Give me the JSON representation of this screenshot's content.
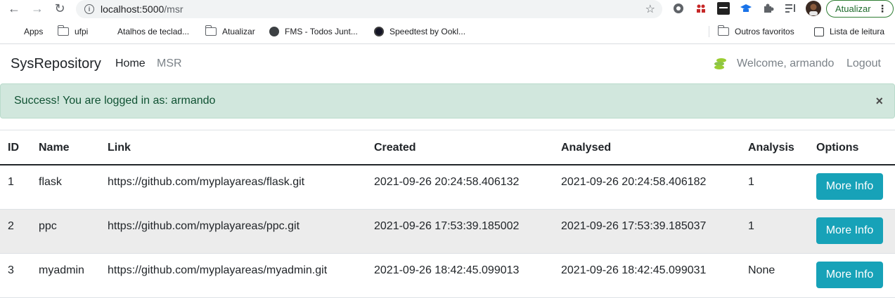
{
  "browser": {
    "url_host": "localhost:5000",
    "url_path": "/msr",
    "update_label": "Atualizar",
    "bookmarks": [
      {
        "label": "Apps",
        "icon": "apps-grid-icon"
      },
      {
        "label": "ufpi",
        "icon": "folder-icon"
      },
      {
        "label": "Atalhos de teclad...",
        "icon": "windows-icon"
      },
      {
        "label": "Atualizar",
        "icon": "folder-icon"
      },
      {
        "label": "FMS - Todos Junt...",
        "icon": "globe-icon"
      },
      {
        "label": "Speedtest by Ookl...",
        "icon": "speedtest-icon"
      }
    ],
    "other_favorites": "Outros favoritos",
    "reading_list": "Lista de leitura"
  },
  "navbar": {
    "brand": "SysRepository",
    "links": [
      "Home",
      "MSR"
    ],
    "welcome": "Welcome, armando",
    "logout": "Logout",
    "accent": "#9acd32"
  },
  "alert": {
    "message": "Success! You are logged in as: armando",
    "close": "×"
  },
  "table": {
    "headers": [
      "ID",
      "Name",
      "Link",
      "Created",
      "Analysed",
      "Analysis",
      "Options"
    ],
    "rows": [
      {
        "id": "1",
        "name": "flask",
        "link": "https://github.com/myplayareas/flask.git",
        "created": "2021-09-26 20:24:58.406132",
        "analysed": "2021-09-26 20:24:58.406182",
        "analysis": "1",
        "option": "More Info"
      },
      {
        "id": "2",
        "name": "ppc",
        "link": "https://github.com/myplayareas/ppc.git",
        "created": "2021-09-26 17:53:39.185002",
        "analysed": "2021-09-26 17:53:39.185037",
        "analysis": "1",
        "option": "More Info"
      },
      {
        "id": "3",
        "name": "myadmin",
        "link": "https://github.com/myplayareas/myadmin.git",
        "created": "2021-09-26 18:42:45.099013",
        "analysed": "2021-09-26 18:42:45.099031",
        "analysis": "None",
        "option": "More Info"
      }
    ]
  }
}
